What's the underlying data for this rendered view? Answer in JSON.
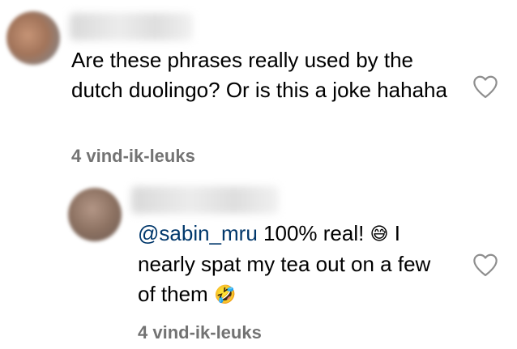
{
  "comment1": {
    "text": "Are these phrases really used by the dutch duolingo? Or is this a joke hahaha",
    "likes": "4 vind-ik-leuks",
    "avatar_color": "#a87a5c"
  },
  "reply1": {
    "mention": "@sabin_mru",
    "text_a": " 100% real! ",
    "emoji_a": "😅",
    "text_b": " I nearly spat my tea out on a few of them ",
    "emoji_b": "🤣",
    "likes": "4 vind-ik-leuks",
    "avatar_color": "#9b8070"
  },
  "icons": {
    "heart": "heart-outline-icon"
  },
  "colors": {
    "text": "#000000",
    "mention": "#00376b",
    "secondary": "#737373"
  }
}
